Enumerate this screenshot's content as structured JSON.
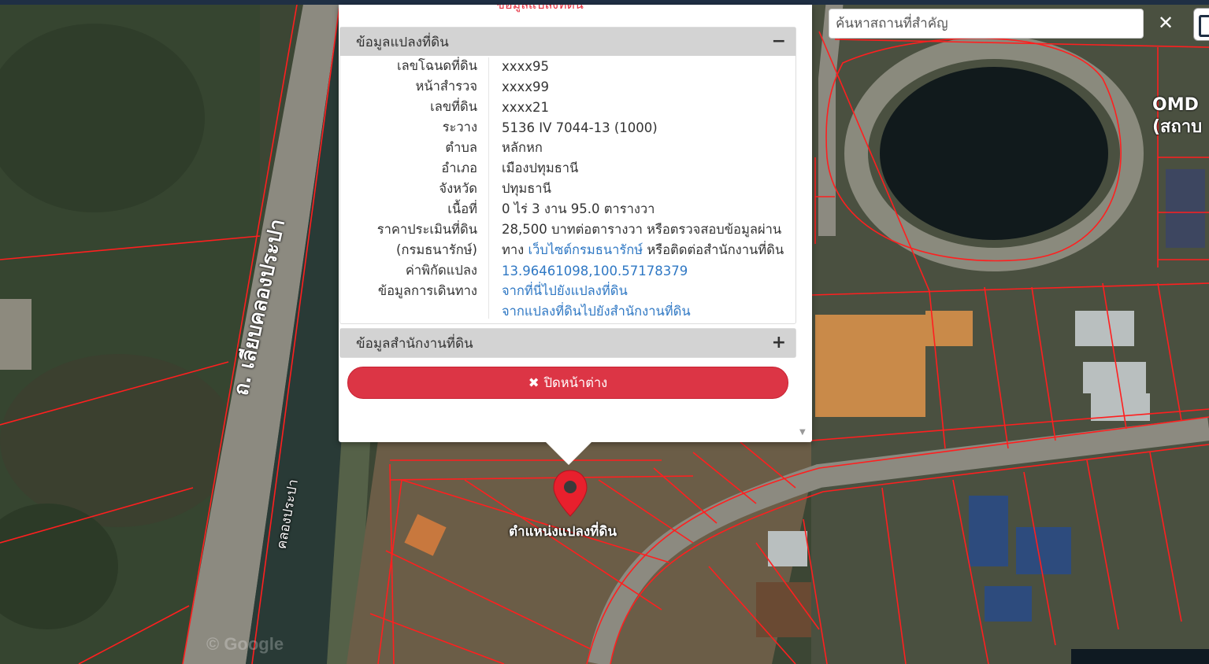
{
  "search": {
    "placeholder": "ค้นหาสถานที่สำคัญ",
    "close_icon": "✕"
  },
  "map": {
    "road_label": "ถ. เลียบคลองประปา",
    "canal_label": "คลองประปา",
    "poi_label_line1": "OMD",
    "poi_label_line2": "(สถาบ",
    "watermark": "© Google",
    "marker_label": "ตำแหน่งแปลงที่ดิน",
    "parcel_color": "#ff1f1f"
  },
  "popup": {
    "top_cut_text": "ข้อมูลแปลงที่ดิน",
    "land_panel": {
      "title": "ข้อมูลแปลงที่ดิน",
      "toggle": "−",
      "rows": [
        {
          "key": "เลขโฉนดที่ดิน",
          "value": "xxxx95"
        },
        {
          "key": "หน้าสำรวจ",
          "value": "xxxx99"
        },
        {
          "key": "เลขที่ดิน",
          "value": "xxxx21"
        },
        {
          "key": "ระวาง",
          "value": "5136 IV 7044-13 (1000)"
        },
        {
          "key": "ตำบล",
          "value": "หลักหก"
        },
        {
          "key": "อำเภอ",
          "value": "เมืองปทุมธานี"
        },
        {
          "key": "จังหวัด",
          "value": "ปทุมธานี"
        },
        {
          "key": "เนื้อที่",
          "value": "0 ไร่ 3 งาน 95.0 ตารางวา"
        }
      ],
      "price": {
        "key1": "ราคาประเมินที่ดิน",
        "key2": "(กรมธนารักษ์)",
        "value_line1": "28,500 บาทต่อตารางวา หรือตรวจสอบข้อมูลผ่าน",
        "value_line2_pre": "ทาง ",
        "value_line2_link": "เว็บไซต์กรมธนารักษ์",
        "value_line2_post": " หรือติดต่อสำนักงานที่ดิน"
      },
      "coords": {
        "key": "ค่าพิกัดแปลง",
        "value": "13.96461098,100.57178379"
      },
      "travel": {
        "key": "ข้อมูลการเดินทาง",
        "link1": "จากที่นี่ไปยังแปลงที่ดิน",
        "link2": "จากแปลงที่ดินไปยังสำนักงานที่ดิน"
      }
    },
    "office_panel": {
      "title": "ข้อมูลสำนักงานที่ดิน",
      "toggle": "+"
    },
    "close_button": {
      "icon": "✖",
      "label": "ปิดหน้าต่าง"
    }
  },
  "colors": {
    "danger": "#dc3545",
    "link": "#2f78c4",
    "navbar": "#1f2f44"
  }
}
